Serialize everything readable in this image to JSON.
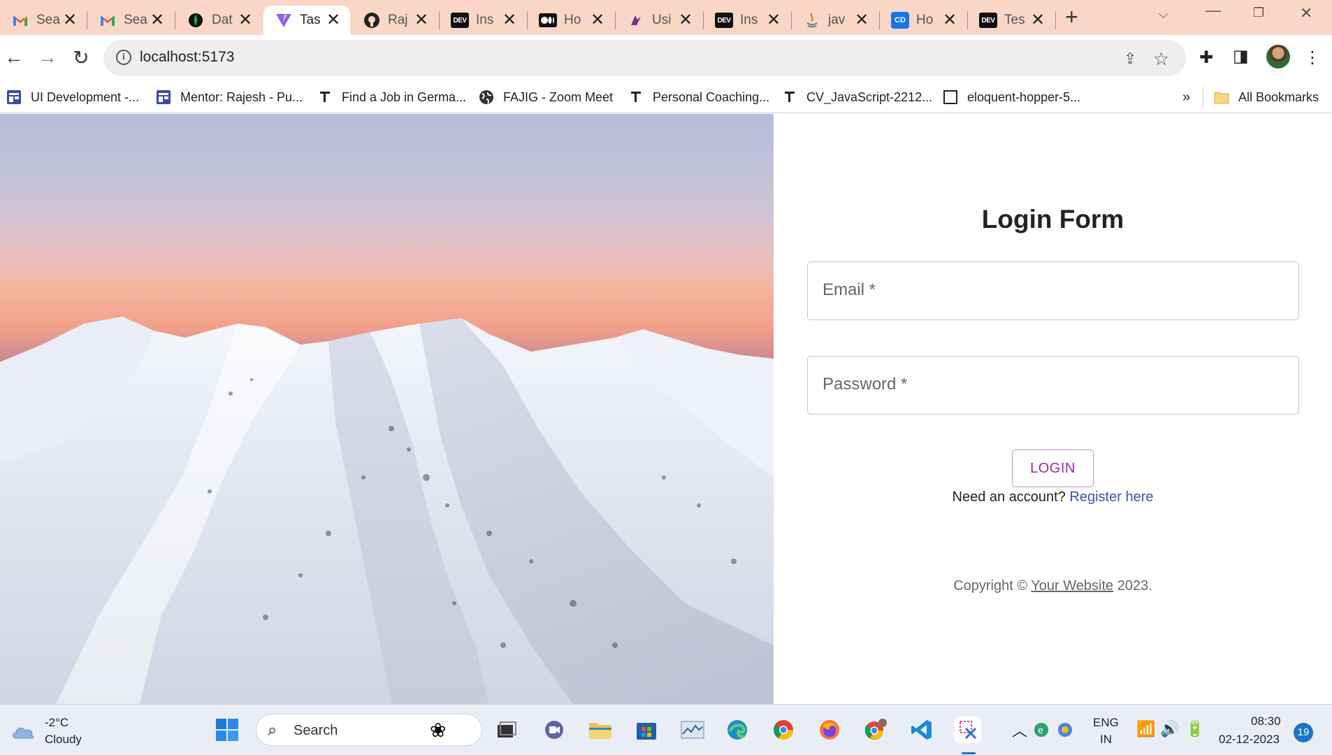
{
  "browser": {
    "tabs": [
      {
        "label": "Sea",
        "icon": "gmail-icon"
      },
      {
        "label": "Sea",
        "icon": "gmail-icon"
      },
      {
        "label": "Dat",
        "icon": "mongodb-icon"
      },
      {
        "label": "Tas",
        "icon": "vite-icon",
        "active": true
      },
      {
        "label": "Raj",
        "icon": "github-icon"
      },
      {
        "label": "Ins",
        "icon": "dev-icon"
      },
      {
        "label": "Ho",
        "icon": "medium-icon"
      },
      {
        "label": "Usi",
        "icon": "hackernoon-icon"
      },
      {
        "label": "Ins",
        "icon": "dev-icon"
      },
      {
        "label": "jav",
        "icon": "java-icon"
      },
      {
        "label": "Ho",
        "icon": "codedamn-icon"
      },
      {
        "label": "Tes",
        "icon": "dev-icon"
      }
    ],
    "address": "localhost:5173",
    "bookmarks": [
      {
        "label": "UI Development -...",
        "icon": "board-icon"
      },
      {
        "label": "Mentor: Rajesh - Pu...",
        "icon": "board-icon"
      },
      {
        "label": "Find a Job in Germa...",
        "icon": "pin-icon"
      },
      {
        "label": "FAJIG - Zoom Meet",
        "icon": "globe-icon"
      },
      {
        "label": "Personal Coaching...",
        "icon": "pin-icon"
      },
      {
        "label": "CV_JavaScript-2212...",
        "icon": "pin-icon"
      },
      {
        "label": "eloquent-hopper-5...",
        "icon": "square-icon"
      }
    ],
    "bookmarks_overflow": "»",
    "all_bookmarks": "All Bookmarks"
  },
  "login": {
    "title": "Login Form",
    "email_label": "Email *",
    "password_label": "Password *",
    "login_button": "LOGIN",
    "account_prompt": "Need an account?",
    "register_link": "Register here",
    "copyright_prefix": "Copyright ©",
    "copyright_link": "Your Website",
    "copyright_year": "2023."
  },
  "taskbar": {
    "weather_temp": "-2°C",
    "weather_desc": "Cloudy",
    "search_label": "Search",
    "lang_top": "ENG",
    "lang_bottom": "IN",
    "time": "08:30",
    "date": "02-12-2023",
    "notifications": "19"
  },
  "colors": {
    "accent_purple": "#9c27b0",
    "link_blue": "#3f51b5",
    "tabstrip": "#f9d6c6"
  }
}
